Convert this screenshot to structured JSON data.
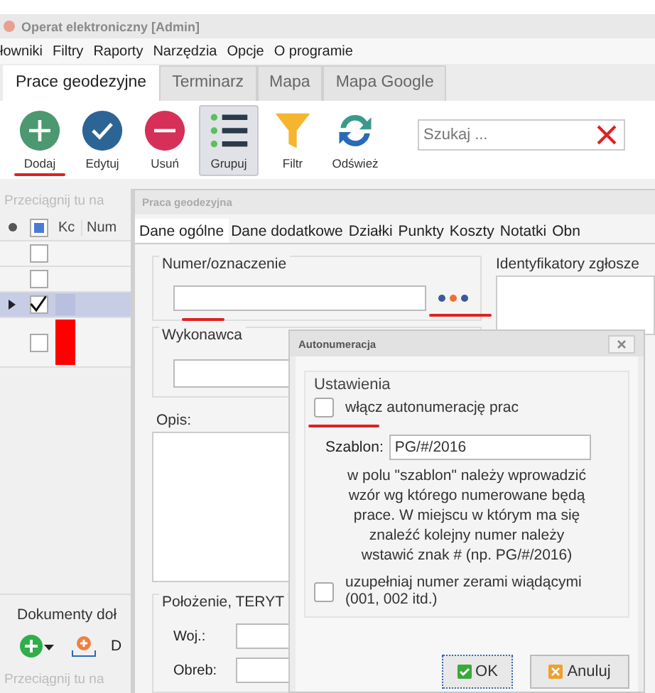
{
  "window": {
    "title": "Operat elektroniczny [Admin]"
  },
  "menu": [
    "łowniki",
    "Filtry",
    "Raporty",
    "Narzędzia",
    "Opcje",
    "O programie"
  ],
  "tabs": [
    {
      "label": "Prace geodezyjne",
      "selected": true
    },
    {
      "label": "Terminarz",
      "selected": false
    },
    {
      "label": "Mapa",
      "selected": false
    },
    {
      "label": "Mapa Google",
      "selected": false
    }
  ],
  "toolbar": [
    {
      "label": "Dodaj",
      "kind": "add",
      "pressed": false,
      "annotated": true
    },
    {
      "label": "Edytuj",
      "kind": "edit",
      "pressed": false,
      "annotated": false
    },
    {
      "label": "Usuń",
      "kind": "remove",
      "pressed": false,
      "annotated": false
    },
    {
      "label": "Grupuj",
      "kind": "group",
      "pressed": true,
      "annotated": false
    },
    {
      "label": "Filtr",
      "kind": "filter",
      "pressed": false,
      "annotated": false
    },
    {
      "label": "Odśwież",
      "kind": "refresh",
      "pressed": false,
      "annotated": false
    }
  ],
  "search": {
    "placeholder": "Szukaj ..."
  },
  "grid": {
    "group_hint": "Przeciągnij tu na",
    "header_checked": true,
    "columns": [
      "Kc",
      "Num"
    ],
    "rows": [
      {
        "checked": false,
        "selected": false
      },
      {
        "checked": false,
        "selected": false
      },
      {
        "checked": true,
        "selected": true,
        "color": "#b8bfdf"
      },
      {
        "checked": false,
        "selected": false,
        "color": "#ff0000"
      }
    ]
  },
  "documents": {
    "title": "Dokumenty doł",
    "button": "D",
    "group_hint": "Przeciągnij tu na"
  },
  "dialog": {
    "title": "Praca geodezyjna",
    "tabs": [
      {
        "label": "Dane ogólne",
        "selected": true
      },
      {
        "label": "Dane dodatkowe",
        "selected": false
      },
      {
        "label": "Działki",
        "selected": false
      },
      {
        "label": "Punkty",
        "selected": false
      },
      {
        "label": "Koszty",
        "selected": false
      },
      {
        "label": "Notatki",
        "selected": false
      },
      {
        "label": "Obn",
        "selected": false
      }
    ],
    "number_label": "Numer/oznaczenie",
    "number_annotated": true,
    "identifiers_label": "Identyfikatory zgłosze",
    "contractor_label": "Wykonawca",
    "description_label": "Opis:",
    "location_label": "Położenie, TERYT",
    "location_fields": [
      "Woj.:",
      "Obreb:"
    ]
  },
  "autonumber": {
    "title": "Autonumeracja",
    "group": "Ustawienia",
    "enable": {
      "label": "włącz autonumerację prac",
      "checked": false,
      "annotated": true
    },
    "template_label": "Szablon:",
    "template_value": "PG/#/2016",
    "help": "w polu \"szablon\" należy wprowadzić wzór wg którego numerowane będą prace. W miejscu w którym ma się znaleźć kolejny numer należy wstawić znak # (np. PG/#/2016)",
    "pad": {
      "label": "uzupełniaj numer zerami wiądącymi (001, 002 itd.)",
      "checked": false
    },
    "buttons": [
      {
        "label": "OK",
        "kind": "ok"
      },
      {
        "label": "Anuluj",
        "kind": "cancel"
      }
    ]
  }
}
